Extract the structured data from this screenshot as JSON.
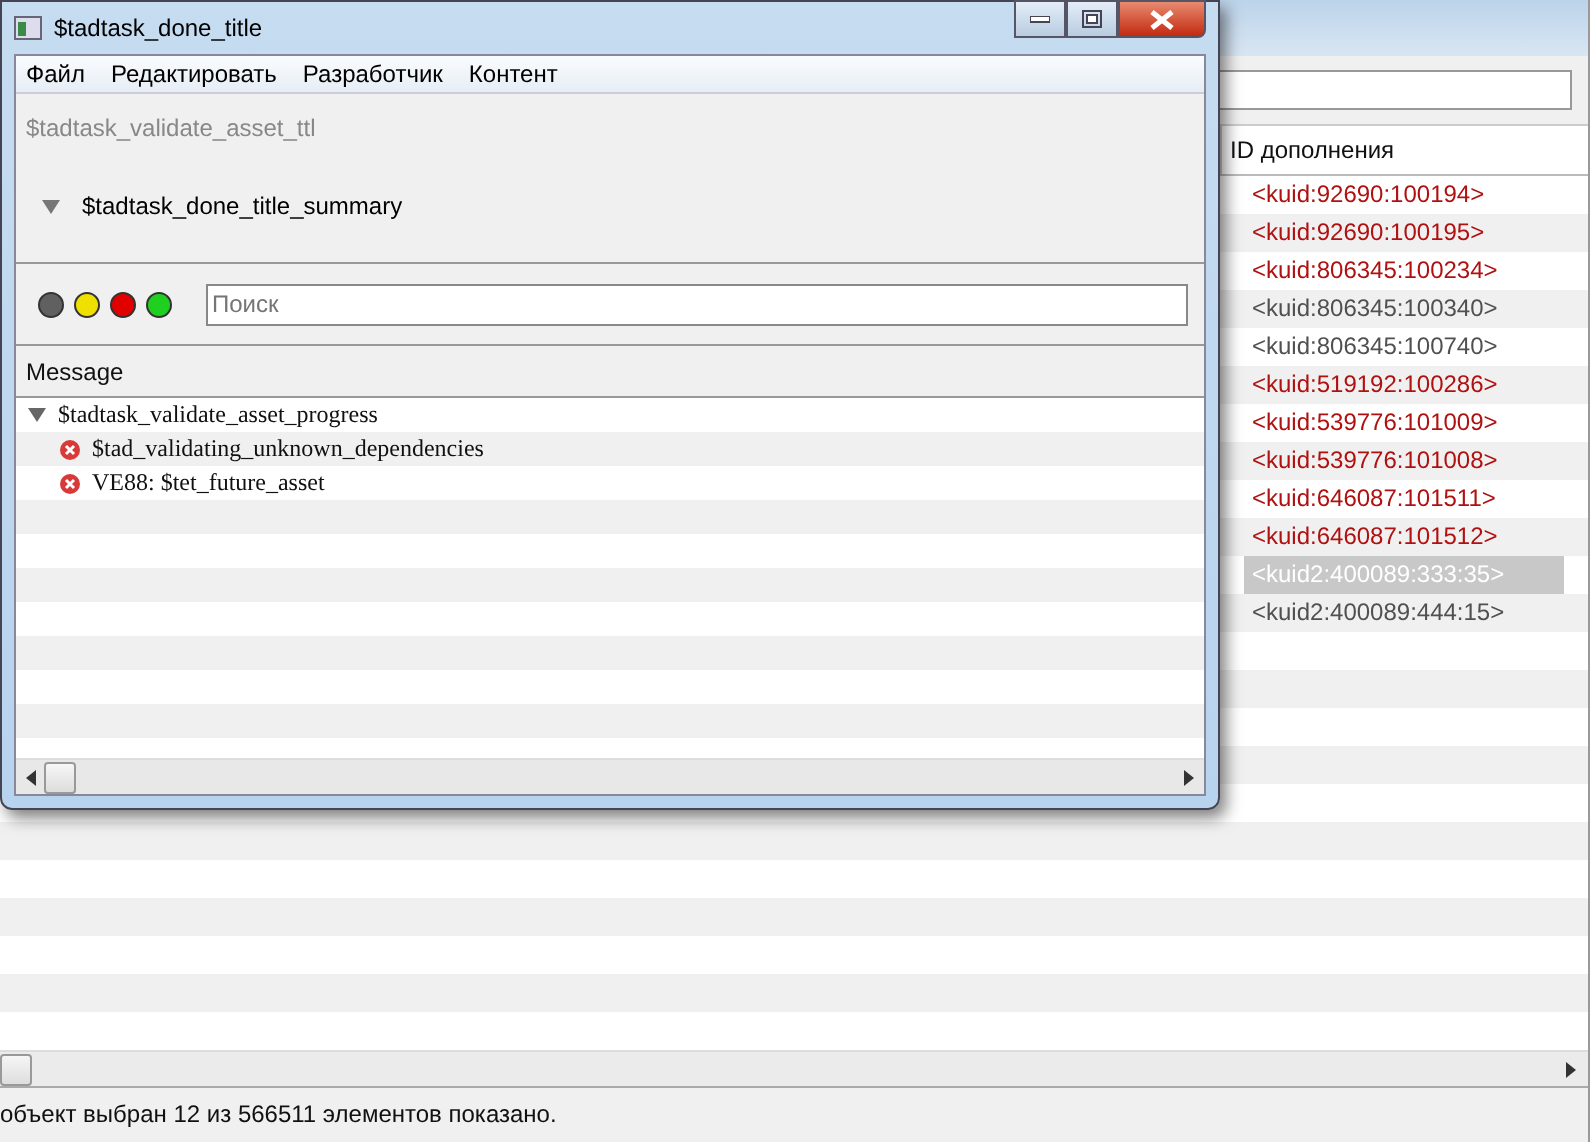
{
  "background": {
    "column": "ID дополнения",
    "rows": [
      {
        "text": "<kuid:92690:100194>",
        "color": "#b01010",
        "selected": false
      },
      {
        "text": "<kuid:92690:100195>",
        "color": "#b01010",
        "selected": false
      },
      {
        "text": "<kuid:806345:100234>",
        "color": "#b01010",
        "selected": false
      },
      {
        "text": "<kuid:806345:100340>",
        "color": "#505050",
        "selected": false
      },
      {
        "text": "<kuid:806345:100740>",
        "color": "#505050",
        "selected": false
      },
      {
        "text": "<kuid:519192:100286>",
        "color": "#b01010",
        "selected": false
      },
      {
        "text": "<kuid:539776:101009>",
        "color": "#b01010",
        "selected": false
      },
      {
        "text": "<kuid:539776:101008>",
        "color": "#b01010",
        "selected": false
      },
      {
        "text": "<kuid:646087:101511>",
        "color": "#b01010",
        "selected": false
      },
      {
        "text": "<kuid:646087:101512>",
        "color": "#b01010",
        "selected": false
      },
      {
        "text": "<kuid2:400089:333:35>",
        "selected": true
      },
      {
        "text": "<kuid2:400089:444:15>",
        "color": "#505050",
        "selected": false
      }
    ],
    "status_bar": "объект выбран 12 из 566511 элементов показано."
  },
  "window": {
    "title": "$tadtask_done_title",
    "menu": [
      "Файл",
      "Редактировать",
      "Разработчик",
      "Контент"
    ],
    "subtitle": "$tadtask_validate_asset_ttl",
    "summary": {
      "label": "$tadtask_done_title_summary",
      "expanded": true
    },
    "filters": [
      {
        "color": "#606060"
      },
      {
        "color": "#f0e000"
      },
      {
        "color": "#e00000"
      },
      {
        "color": "#20d020"
      }
    ],
    "search": {
      "placeholder": "Поиск"
    },
    "table": {
      "columns": [
        "Message"
      ],
      "rows": [
        {
          "text": "$tadtask_validate_asset_progress",
          "expanded": true,
          "children": [
            {
              "text": "$tad_validating_unknown_dependencies",
              "kind": "error"
            },
            {
              "text": "VE88: $tet_future_asset",
              "kind": "error"
            }
          ]
        }
      ]
    }
  }
}
